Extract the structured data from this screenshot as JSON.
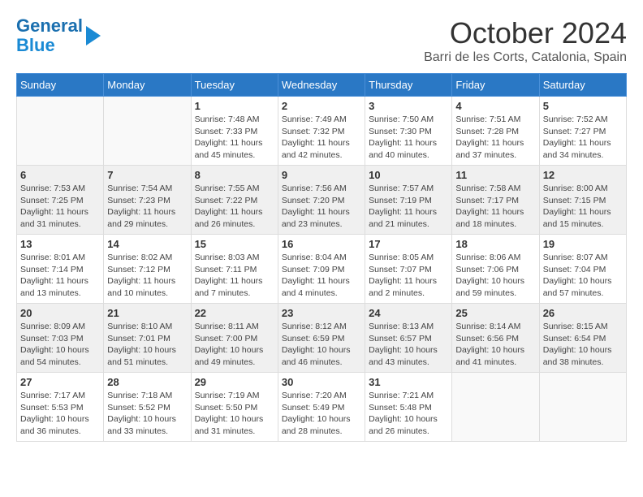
{
  "logo": {
    "line1": "General",
    "line2": "Blue"
  },
  "title": "October 2024",
  "location": "Barri de les Corts, Catalonia, Spain",
  "days_of_week": [
    "Sunday",
    "Monday",
    "Tuesday",
    "Wednesday",
    "Thursday",
    "Friday",
    "Saturday"
  ],
  "weeks": [
    [
      {
        "day": "",
        "detail": ""
      },
      {
        "day": "",
        "detail": ""
      },
      {
        "day": "1",
        "detail": "Sunrise: 7:48 AM\nSunset: 7:33 PM\nDaylight: 11 hours and 45 minutes."
      },
      {
        "day": "2",
        "detail": "Sunrise: 7:49 AM\nSunset: 7:32 PM\nDaylight: 11 hours and 42 minutes."
      },
      {
        "day": "3",
        "detail": "Sunrise: 7:50 AM\nSunset: 7:30 PM\nDaylight: 11 hours and 40 minutes."
      },
      {
        "day": "4",
        "detail": "Sunrise: 7:51 AM\nSunset: 7:28 PM\nDaylight: 11 hours and 37 minutes."
      },
      {
        "day": "5",
        "detail": "Sunrise: 7:52 AM\nSunset: 7:27 PM\nDaylight: 11 hours and 34 minutes."
      }
    ],
    [
      {
        "day": "6",
        "detail": "Sunrise: 7:53 AM\nSunset: 7:25 PM\nDaylight: 11 hours and 31 minutes."
      },
      {
        "day": "7",
        "detail": "Sunrise: 7:54 AM\nSunset: 7:23 PM\nDaylight: 11 hours and 29 minutes."
      },
      {
        "day": "8",
        "detail": "Sunrise: 7:55 AM\nSunset: 7:22 PM\nDaylight: 11 hours and 26 minutes."
      },
      {
        "day": "9",
        "detail": "Sunrise: 7:56 AM\nSunset: 7:20 PM\nDaylight: 11 hours and 23 minutes."
      },
      {
        "day": "10",
        "detail": "Sunrise: 7:57 AM\nSunset: 7:19 PM\nDaylight: 11 hours and 21 minutes."
      },
      {
        "day": "11",
        "detail": "Sunrise: 7:58 AM\nSunset: 7:17 PM\nDaylight: 11 hours and 18 minutes."
      },
      {
        "day": "12",
        "detail": "Sunrise: 8:00 AM\nSunset: 7:15 PM\nDaylight: 11 hours and 15 minutes."
      }
    ],
    [
      {
        "day": "13",
        "detail": "Sunrise: 8:01 AM\nSunset: 7:14 PM\nDaylight: 11 hours and 13 minutes."
      },
      {
        "day": "14",
        "detail": "Sunrise: 8:02 AM\nSunset: 7:12 PM\nDaylight: 11 hours and 10 minutes."
      },
      {
        "day": "15",
        "detail": "Sunrise: 8:03 AM\nSunset: 7:11 PM\nDaylight: 11 hours and 7 minutes."
      },
      {
        "day": "16",
        "detail": "Sunrise: 8:04 AM\nSunset: 7:09 PM\nDaylight: 11 hours and 4 minutes."
      },
      {
        "day": "17",
        "detail": "Sunrise: 8:05 AM\nSunset: 7:07 PM\nDaylight: 11 hours and 2 minutes."
      },
      {
        "day": "18",
        "detail": "Sunrise: 8:06 AM\nSunset: 7:06 PM\nDaylight: 10 hours and 59 minutes."
      },
      {
        "day": "19",
        "detail": "Sunrise: 8:07 AM\nSunset: 7:04 PM\nDaylight: 10 hours and 57 minutes."
      }
    ],
    [
      {
        "day": "20",
        "detail": "Sunrise: 8:09 AM\nSunset: 7:03 PM\nDaylight: 10 hours and 54 minutes."
      },
      {
        "day": "21",
        "detail": "Sunrise: 8:10 AM\nSunset: 7:01 PM\nDaylight: 10 hours and 51 minutes."
      },
      {
        "day": "22",
        "detail": "Sunrise: 8:11 AM\nSunset: 7:00 PM\nDaylight: 10 hours and 49 minutes."
      },
      {
        "day": "23",
        "detail": "Sunrise: 8:12 AM\nSunset: 6:59 PM\nDaylight: 10 hours and 46 minutes."
      },
      {
        "day": "24",
        "detail": "Sunrise: 8:13 AM\nSunset: 6:57 PM\nDaylight: 10 hours and 43 minutes."
      },
      {
        "day": "25",
        "detail": "Sunrise: 8:14 AM\nSunset: 6:56 PM\nDaylight: 10 hours and 41 minutes."
      },
      {
        "day": "26",
        "detail": "Sunrise: 8:15 AM\nSunset: 6:54 PM\nDaylight: 10 hours and 38 minutes."
      }
    ],
    [
      {
        "day": "27",
        "detail": "Sunrise: 7:17 AM\nSunset: 5:53 PM\nDaylight: 10 hours and 36 minutes."
      },
      {
        "day": "28",
        "detail": "Sunrise: 7:18 AM\nSunset: 5:52 PM\nDaylight: 10 hours and 33 minutes."
      },
      {
        "day": "29",
        "detail": "Sunrise: 7:19 AM\nSunset: 5:50 PM\nDaylight: 10 hours and 31 minutes."
      },
      {
        "day": "30",
        "detail": "Sunrise: 7:20 AM\nSunset: 5:49 PM\nDaylight: 10 hours and 28 minutes."
      },
      {
        "day": "31",
        "detail": "Sunrise: 7:21 AM\nSunset: 5:48 PM\nDaylight: 10 hours and 26 minutes."
      },
      {
        "day": "",
        "detail": ""
      },
      {
        "day": "",
        "detail": ""
      }
    ]
  ]
}
